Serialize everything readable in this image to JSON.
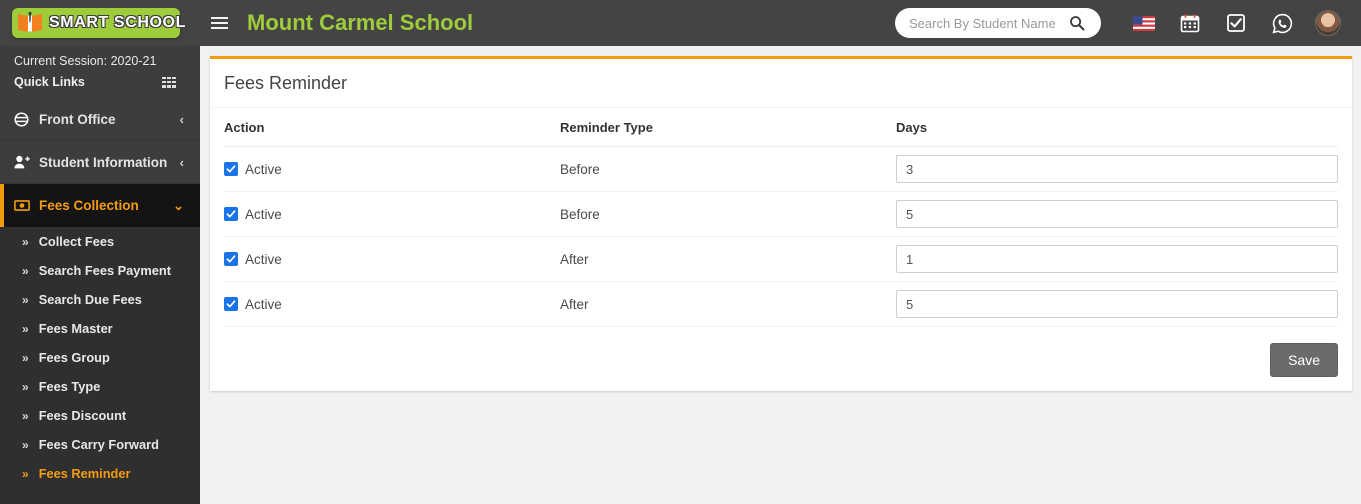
{
  "header": {
    "logo_text": "SMART SCHOOL",
    "logo_icon": "open-book-icon",
    "menu_icon": "hamburger-menu-icon",
    "school_title": "Mount Carmel School",
    "search": {
      "placeholder": "Search By Student Name",
      "value": "",
      "icon": "search-icon"
    },
    "icons": [
      {
        "name": "language-flag-icon",
        "label": "US"
      },
      {
        "name": "calendar-icon",
        "label": "Calendar"
      },
      {
        "name": "task-check-icon",
        "label": "Tasks"
      },
      {
        "name": "whatsapp-icon",
        "label": "WhatsApp"
      }
    ],
    "avatar": "user-avatar"
  },
  "sidebar": {
    "session_label": "Current Session: 2020-21",
    "quick_links_label": "Quick Links",
    "quick_links_icon": "grid-icon",
    "nav": [
      {
        "label": "Front Office",
        "icon": "front-office-icon",
        "chevron": "‹",
        "active": false
      },
      {
        "label": "Student Information",
        "icon": "student-add-icon",
        "chevron": "‹",
        "active": false
      },
      {
        "label": "Fees Collection",
        "icon": "money-icon",
        "chevron": "⌄",
        "active": true
      }
    ],
    "sub_items": [
      {
        "label": "Collect Fees",
        "current": false
      },
      {
        "label": "Search Fees Payment",
        "current": false
      },
      {
        "label": "Search Due Fees",
        "current": false
      },
      {
        "label": "Fees Master",
        "current": false
      },
      {
        "label": "Fees Group",
        "current": false
      },
      {
        "label": "Fees Type",
        "current": false
      },
      {
        "label": "Fees Discount",
        "current": false
      },
      {
        "label": "Fees Carry Forward",
        "current": false
      },
      {
        "label": "Fees Reminder",
        "current": true
      }
    ]
  },
  "main": {
    "card_title": "Fees Reminder",
    "columns": [
      "Action",
      "Reminder Type",
      "Days"
    ],
    "rows": [
      {
        "action_label": "Active",
        "checked": true,
        "reminder_type": "Before",
        "days": "3"
      },
      {
        "action_label": "Active",
        "checked": true,
        "reminder_type": "Before",
        "days": "5"
      },
      {
        "action_label": "Active",
        "checked": true,
        "reminder_type": "After",
        "days": "1"
      },
      {
        "action_label": "Active",
        "checked": true,
        "reminder_type": "After",
        "days": "5"
      }
    ],
    "save_label": "Save"
  },
  "colors": {
    "accent_orange": "#f39c12",
    "brand_green": "#9ecc3b",
    "header_dark": "#444444",
    "sidebar_dark": "#2f2f2f",
    "checkbox_blue": "#1a73e8",
    "save_gray": "#6b6b6b"
  }
}
